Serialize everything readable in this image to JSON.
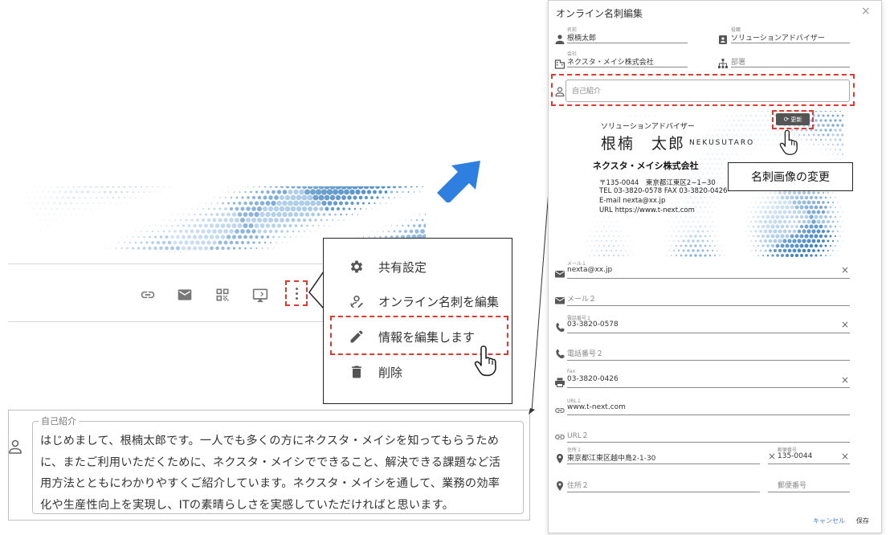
{
  "menu": {
    "items": [
      {
        "label": "共有設定",
        "icon": "gear-icon"
      },
      {
        "label": "オンライン名刺を編集",
        "icon": "person-edit-icon"
      },
      {
        "label": "情報を編集します",
        "icon": "pencil-icon"
      },
      {
        "label": "削除",
        "icon": "trash-icon"
      }
    ]
  },
  "actions": [
    "link-icon",
    "mail-icon",
    "qr-code-icon",
    "screen-icon",
    "more-vert-icon"
  ],
  "intro": {
    "legend": "自己紹介",
    "lines": [
      "はじめまして、根楠太郎です。一人でも多くの方にネクスタ・メイシを知ってもらうため",
      "に、またご利用いただくために、ネクスタ・メイシでできること、解決できる課題など活",
      "用方法とともにわかりやすくご紹介しています。ネクスタ・メイシを通して、業務の効率",
      "化や生産性向上を実現し、ITの素晴らしさを実感していただければと思います。"
    ]
  },
  "dialog": {
    "title": "オンライン名刺編集",
    "close": "×",
    "fields": {
      "name": {
        "label": "名前",
        "value": "根楠太郎"
      },
      "role": {
        "label": "役職",
        "value": "ソリューションアドバイザー"
      },
      "company": {
        "label": "会社",
        "value": "ネクスタ・メイシ株式会社"
      },
      "dept": {
        "placeholder": "部署"
      },
      "intro": {
        "placeholder": "自己紹介"
      },
      "mail1": {
        "label": "メール１",
        "value": "nexta@xx.jp"
      },
      "mail2": {
        "placeholder": "メール２"
      },
      "tel1": {
        "label": "電話番号１",
        "value": "03-3820-0578"
      },
      "tel2": {
        "placeholder": "電話番号２"
      },
      "fax": {
        "label": "Fax",
        "value": "03-3820-0426"
      },
      "url1": {
        "label": "URL１",
        "value": "www.t-next.com"
      },
      "url2": {
        "placeholder": "URL２"
      },
      "addr1": {
        "label": "住所１",
        "value": "東京都江東区越中島2-1-30"
      },
      "zip1": {
        "label": "郵便番号",
        "value": "135-0044"
      },
      "addr2": {
        "placeholder": "住所２"
      },
      "zip2": {
        "placeholder": "郵便番号"
      }
    },
    "clear": "×",
    "cancel": "キャンセル",
    "save": "保存"
  },
  "card_image": {
    "role": "ソリューションアドバイザー",
    "name": "根楠　太郎",
    "roma": "NEKUSUTARO",
    "company": "ネクスタ・メイシ株式会社",
    "address": "〒135-0044　東京都江東区2−1−30",
    "telfax": "TEL 03-3820-0578  FAX 03-3820-0426",
    "email": "E-mail nexta@xx.jp",
    "url": "URL https://www.t-next.com",
    "update_label": "更新"
  },
  "callout": "名刺画像の変更"
}
